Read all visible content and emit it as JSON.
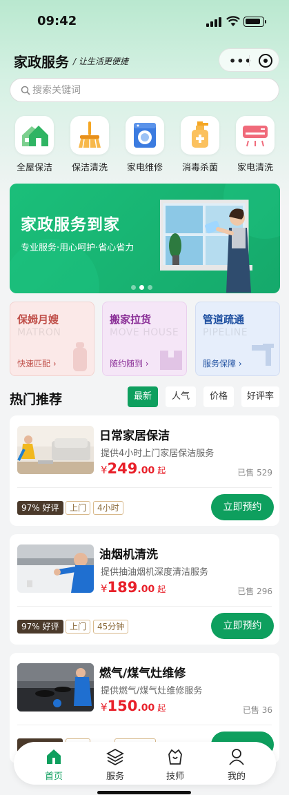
{
  "status": {
    "time": "09:42"
  },
  "header": {
    "title": "家政服务",
    "slogan": "/ 让生活更便捷"
  },
  "capsule": {
    "more": "•••"
  },
  "search": {
    "placeholder": "搜索关键词"
  },
  "categories": [
    {
      "label": "全屋保洁",
      "icon": "house-icon"
    },
    {
      "label": "保洁清洗",
      "icon": "broom-icon"
    },
    {
      "label": "家电维修",
      "icon": "washer-icon"
    },
    {
      "label": "消毒杀菌",
      "icon": "spray-bottle-icon"
    },
    {
      "label": "家电清洗",
      "icon": "air-conditioner-icon"
    }
  ],
  "banner": {
    "title": "家政服务到家",
    "subtitle": "专业服务·用心呵护·省心省力",
    "slides": 3,
    "active_slide": 2
  },
  "features": [
    {
      "title": "保姆月嫂",
      "en": "MATRON",
      "link": "快速匹配 ›",
      "color": "#c0504a",
      "bg": "#fbe9e8"
    },
    {
      "title": "搬家拉货",
      "en": "MOVE HOUSE",
      "link": "随约随到 ›",
      "color": "#8a2f97",
      "bg": "#f5e6f7"
    },
    {
      "title": "管道疏通",
      "en": "PIPELINE",
      "link": "服务保障 ›",
      "color": "#1e4fa0",
      "bg": "#e6eefb"
    }
  ],
  "section": {
    "title": "热门推荐",
    "tabs": [
      "最新",
      "人气",
      "价格",
      "好评率"
    ],
    "active_tab": "最新"
  },
  "services": [
    {
      "name": "日常家居保洁",
      "desc": "提供4小时上门家居保洁服务",
      "yen": "¥",
      "price": "249",
      "dec": ".00",
      "qi": "起",
      "sold": "已售 529",
      "rating": "97% 好评",
      "tags": [
        "上门",
        "4小时"
      ],
      "button": "立即预约"
    },
    {
      "name": "油烟机清洗",
      "desc": "提供抽油烟机深度清洁服务",
      "yen": "¥",
      "price": "189",
      "dec": ".00",
      "qi": "起",
      "sold": "已售 296",
      "rating": "97% 好评",
      "tags": [
        "上门",
        "45分钟"
      ],
      "button": "立即预约"
    },
    {
      "name": "燃气/煤气灶维修",
      "desc": "提供燃气/煤气灶维修服务",
      "yen": "¥",
      "price": "150",
      "dec": ".00",
      "qi": "起",
      "sold": "已售 36",
      "rating": "",
      "tags": [],
      "button": ""
    }
  ],
  "tabbar": [
    {
      "label": "首页",
      "icon": "home-icon",
      "active": true
    },
    {
      "label": "服务",
      "icon": "layers-icon",
      "active": false
    },
    {
      "label": "技师",
      "icon": "technician-icon",
      "active": false
    },
    {
      "label": "我的",
      "icon": "user-icon",
      "active": false
    }
  ],
  "colors": {
    "accent": "#0e9f5e",
    "price": "#e8202a",
    "rating_tag": "#4b3a2b"
  }
}
